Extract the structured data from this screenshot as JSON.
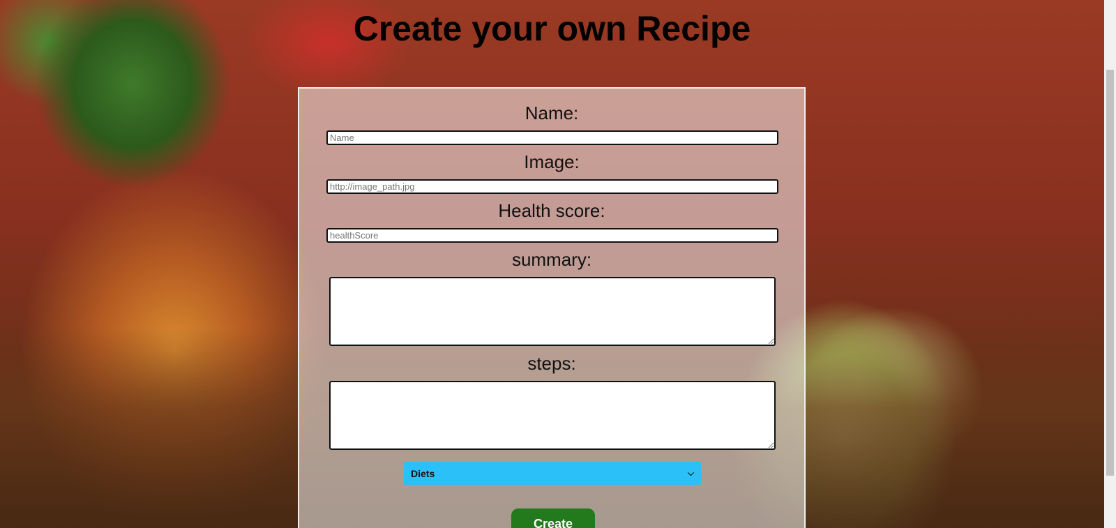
{
  "page": {
    "title": "Create your own Recipe"
  },
  "form": {
    "name_label": "Name:",
    "name_placeholder": "Name",
    "image_label": "Image:",
    "image_placeholder": "http://image_path.jpg",
    "health_label": "Health score:",
    "health_placeholder": "healthScore",
    "summary_label": "summary:",
    "steps_label": "steps:",
    "diets_select": "Diets",
    "create_label": "Create"
  },
  "colors": {
    "select_bg": "#2bc0f7",
    "button_bg": "#227a1d"
  }
}
